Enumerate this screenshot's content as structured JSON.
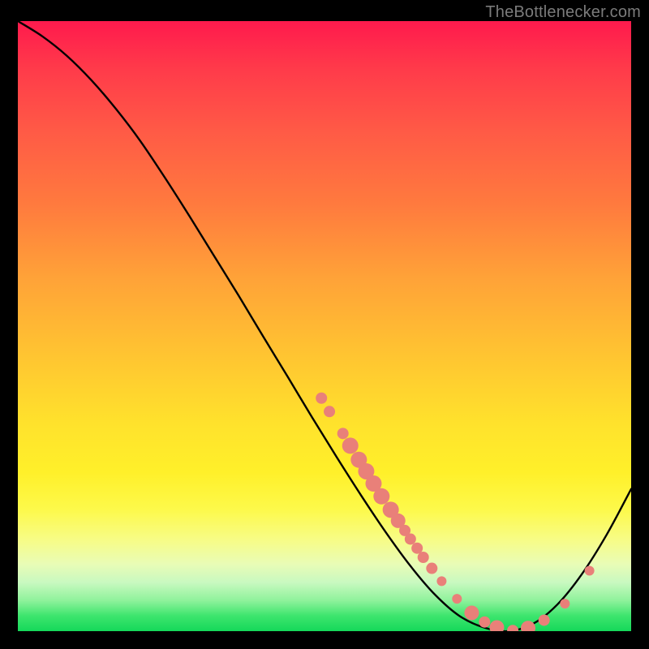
{
  "attribution": "TheBottlenecker.com",
  "chart_data": {
    "type": "line",
    "title": "",
    "xlabel": "",
    "ylabel": "",
    "xlim": [
      0,
      100
    ],
    "ylim": [
      0,
      100
    ],
    "series": [
      {
        "name": "curve",
        "x": [
          0,
          4,
          8,
          12,
          16,
          20,
          24,
          28,
          32,
          36,
          40,
          44,
          48,
          52,
          56,
          60,
          64,
          68,
          72,
          76,
          80,
          84,
          88,
          92,
          96,
          100
        ],
        "y": [
          100,
          97.5,
          94.3,
          90.3,
          85.6,
          80.3,
          74.3,
          68.0,
          61.5,
          55.0,
          48.3,
          41.7,
          35.0,
          28.5,
          22.2,
          16.2,
          10.7,
          6.0,
          2.5,
          0.6,
          0.0,
          1.2,
          4.4,
          9.4,
          15.8,
          23.3
        ]
      }
    ],
    "markers": [
      {
        "x": 49.5,
        "y": 38.2,
        "r": 7
      },
      {
        "x": 50.8,
        "y": 36.0,
        "r": 7
      },
      {
        "x": 53.0,
        "y": 32.4,
        "r": 7
      },
      {
        "x": 54.2,
        "y": 30.4,
        "r": 10
      },
      {
        "x": 55.6,
        "y": 28.1,
        "r": 10
      },
      {
        "x": 56.8,
        "y": 26.2,
        "r": 10
      },
      {
        "x": 58.0,
        "y": 24.2,
        "r": 10
      },
      {
        "x": 59.3,
        "y": 22.1,
        "r": 10
      },
      {
        "x": 60.8,
        "y": 19.9,
        "r": 10
      },
      {
        "x": 62.0,
        "y": 18.1,
        "r": 9
      },
      {
        "x": 63.1,
        "y": 16.5,
        "r": 7
      },
      {
        "x": 64.0,
        "y": 15.1,
        "r": 7
      },
      {
        "x": 65.1,
        "y": 13.6,
        "r": 7
      },
      {
        "x": 66.1,
        "y": 12.1,
        "r": 7
      },
      {
        "x": 67.5,
        "y": 10.3,
        "r": 7
      },
      {
        "x": 69.1,
        "y": 8.2,
        "r": 6
      },
      {
        "x": 71.6,
        "y": 5.3,
        "r": 6
      },
      {
        "x": 74.0,
        "y": 3.0,
        "r": 9
      },
      {
        "x": 76.1,
        "y": 1.5,
        "r": 7
      },
      {
        "x": 78.1,
        "y": 0.6,
        "r": 9
      },
      {
        "x": 80.7,
        "y": 0.1,
        "r": 7
      },
      {
        "x": 83.2,
        "y": 0.5,
        "r": 9
      },
      {
        "x": 85.8,
        "y": 1.8,
        "r": 7
      },
      {
        "x": 89.2,
        "y": 4.5,
        "r": 6
      },
      {
        "x": 93.2,
        "y": 9.9,
        "r": 6
      }
    ],
    "colors": {
      "curve": "#000000",
      "marker_fill": "#e98079",
      "marker_stroke": "#d96a63"
    }
  }
}
